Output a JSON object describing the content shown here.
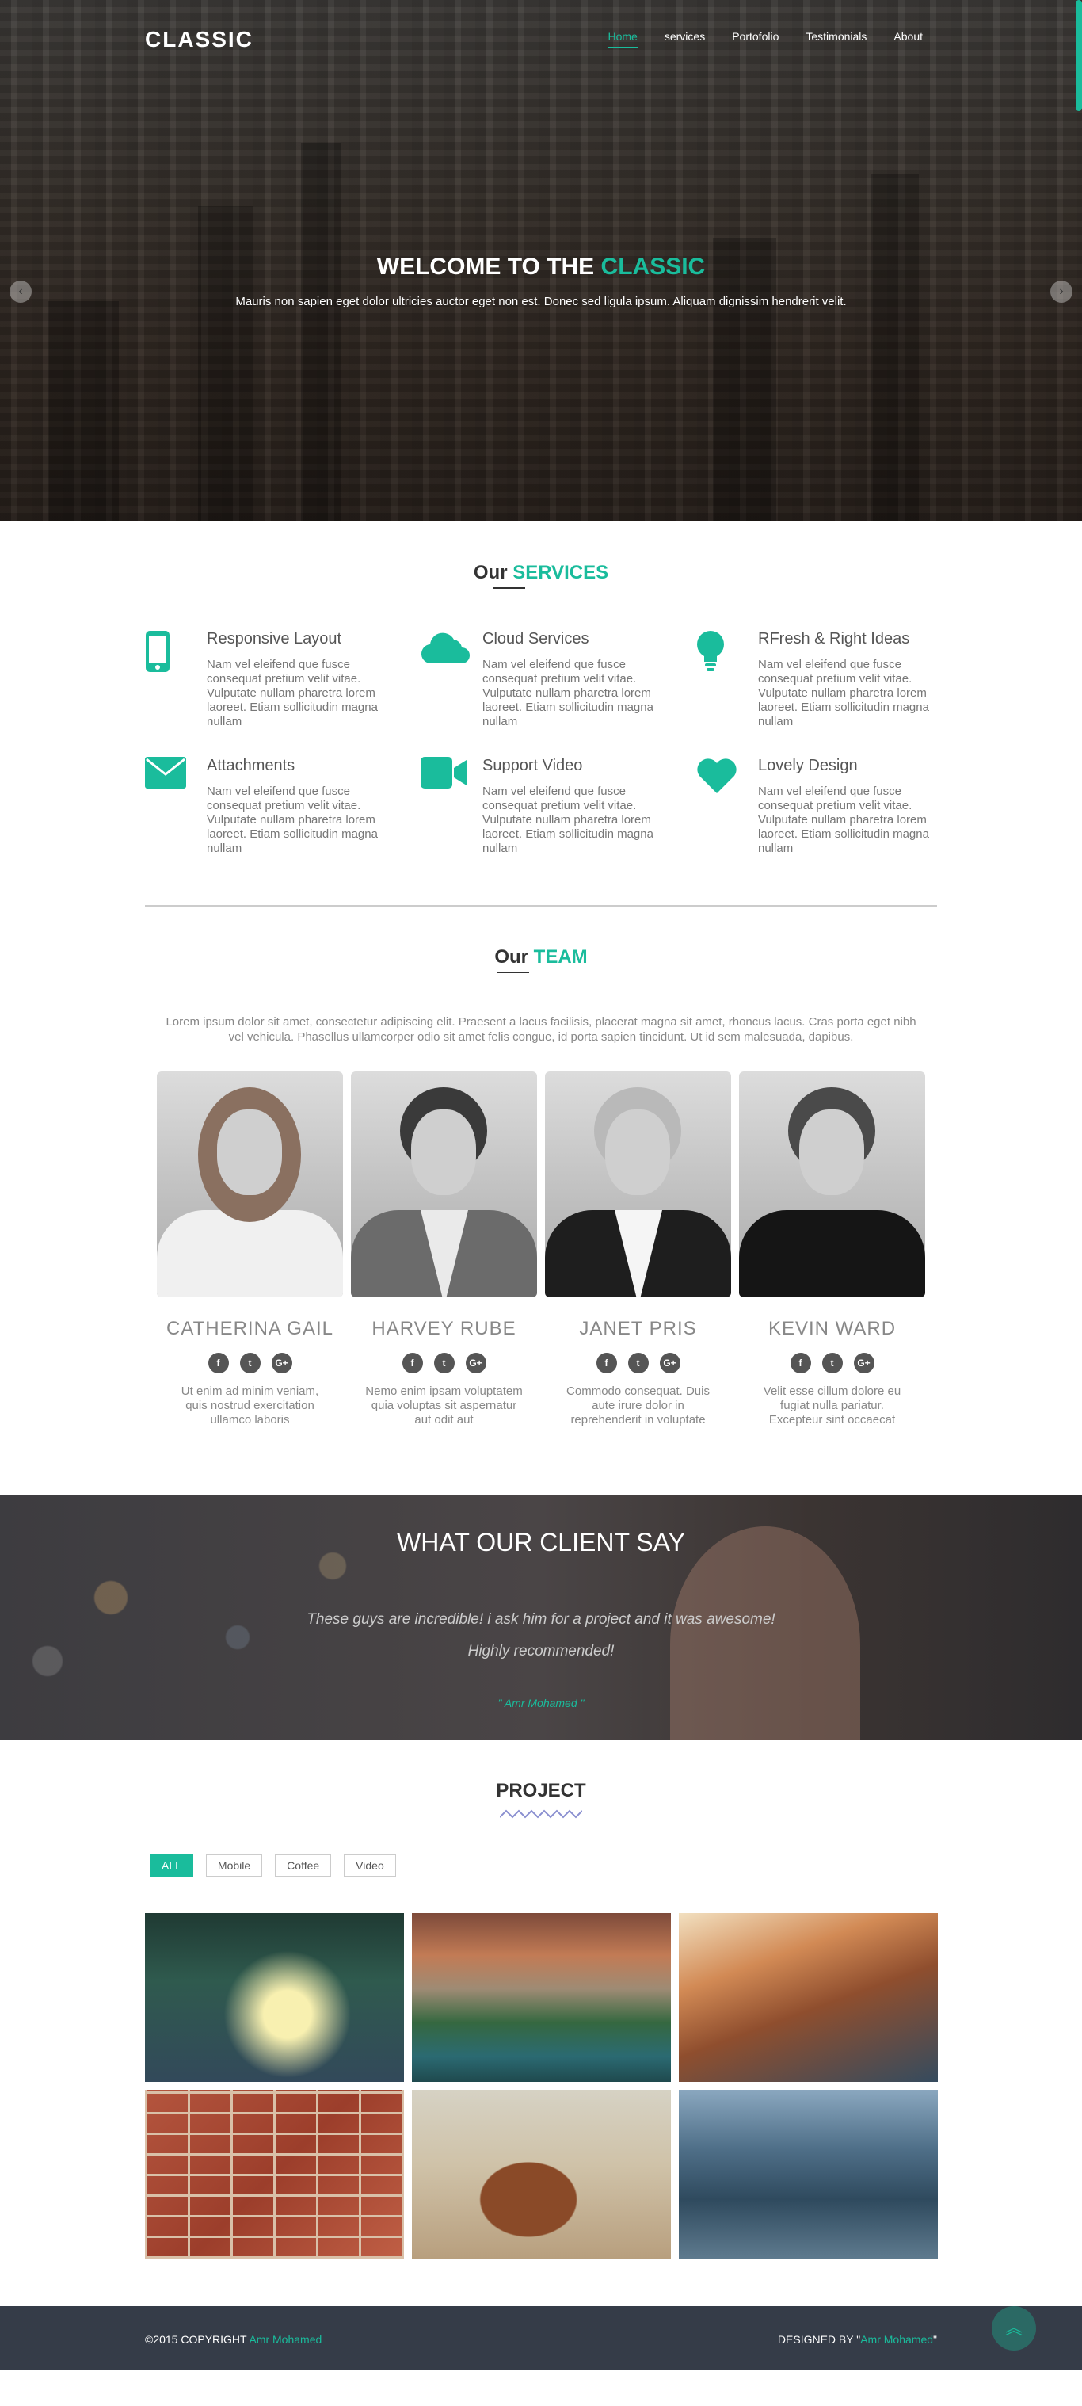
{
  "brand": {
    "logo": "CLASSIC",
    "accent": "#1abc9c"
  },
  "nav": {
    "items": [
      "Home",
      "services",
      "Portofolio",
      "Testimonials",
      "About"
    ],
    "active": "Home"
  },
  "hero": {
    "title_prefix": "WELCOME TO THE",
    "title_accent": "CLASSIC",
    "subtitle": "Mauris non sapien eget dolor ultricies auctor eget non est. Donec sed ligula ipsum. Aliquam dignissim hendrerit velit."
  },
  "services": {
    "title_prefix": "Our",
    "title_accent": "SERVICES",
    "items": [
      {
        "icon": "mobile-icon",
        "title": "Responsive Layout",
        "text": "Nam vel eleifend que fusce consequat pretium velit vitae. Vulputate nullam pharetra lorem laoreet. Etiam sollicitudin magna nullam"
      },
      {
        "icon": "cloud-icon",
        "title": "Cloud Services",
        "text": "Nam vel eleifend que fusce consequat pretium velit vitae. Vulputate nullam pharetra lorem laoreet. Etiam sollicitudin magna nullam"
      },
      {
        "icon": "lightbulb-icon",
        "title": "RFresh & Right Ideas",
        "text": "Nam vel eleifend que fusce consequat pretium velit vitae. Vulputate nullam pharetra lorem laoreet. Etiam sollicitudin magna nullam"
      },
      {
        "icon": "envelope-icon",
        "title": "Attachments",
        "text": "Nam vel eleifend que fusce consequat pretium velit vitae. Vulputate nullam pharetra lorem laoreet. Etiam sollicitudin magna nullam"
      },
      {
        "icon": "video-camera-icon",
        "title": "Support Video",
        "text": "Nam vel eleifend que fusce consequat pretium velit vitae. Vulputate nullam pharetra lorem laoreet. Etiam sollicitudin magna nullam"
      },
      {
        "icon": "heart-icon",
        "title": "Lovely Design",
        "text": "Nam vel eleifend que fusce consequat pretium velit vitae. Vulputate nullam pharetra lorem laoreet. Etiam sollicitudin magna nullam"
      }
    ]
  },
  "team": {
    "title_prefix": "Our",
    "title_accent": "TEAM",
    "intro": "Lorem ipsum dolor sit amet, consectetur adipiscing elit. Praesent a lacus facilisis, placerat magna sit amet, rhoncus lacus. Cras porta eget nibh vel vehicula. Phasellus ullamcorper odio sit amet felis congue, id porta sapien tincidunt. Ut id sem malesuada, dapibus.",
    "members": [
      {
        "name": "CATHERINA GAIL",
        "bio": "Ut enim ad minim veniam, quis nostrud exercitation ullamco laboris"
      },
      {
        "name": "HARVEY RUBE",
        "bio": "Nemo enim ipsam voluptatem quia voluptas sit aspernatur aut odit aut"
      },
      {
        "name": "JANET PRIS",
        "bio": "Commodo consequat. Duis aute irure dolor in reprehenderit in voluptate"
      },
      {
        "name": "KEVIN WARD",
        "bio": "Velit esse cillum dolore eu fugiat nulla pariatur. Excepteur sint occaecat"
      }
    ],
    "social": [
      "f",
      "t",
      "G+"
    ]
  },
  "testimonials": {
    "title": "WHAT OUR CLIENT SAY",
    "quote_line1": "These guys are incredible! i ask him for a project and it was awesome!",
    "quote_line2": "Highly recommended!",
    "author": "\" Amr Mohamed \""
  },
  "project": {
    "title": "PROJECT",
    "filters": [
      "ALL",
      "Mobile",
      "Coffee",
      "Video"
    ],
    "active_filter": "ALL"
  },
  "footer": {
    "copyright_prefix": "©2015 COPYRIGHT",
    "copyright_name": "Amr Mohamed",
    "designed_prefix": "DESIGNED BY \"",
    "designed_name": "Amr Mohamed",
    "designed_suffix": "\""
  }
}
